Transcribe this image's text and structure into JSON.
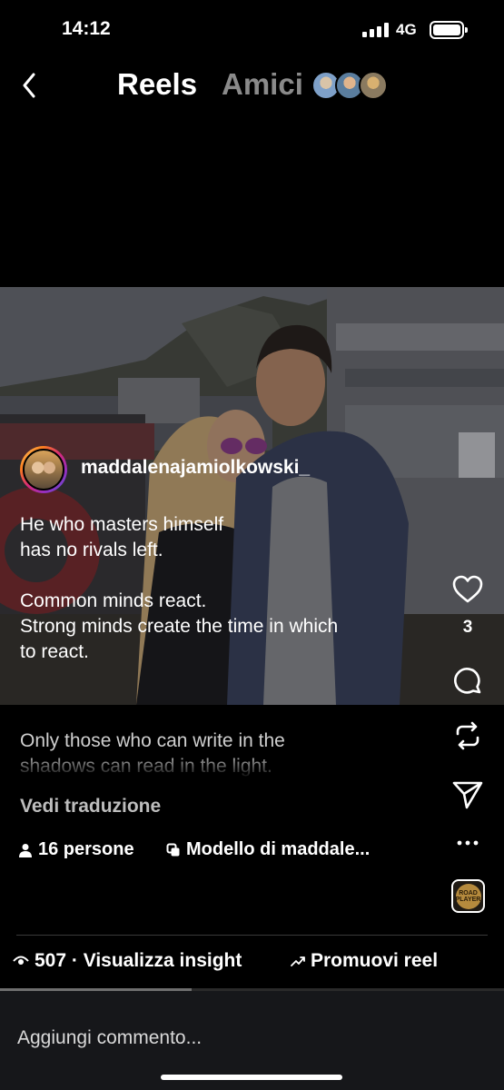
{
  "status": {
    "time": "14:12",
    "network": "4G",
    "battery_level": 1.0
  },
  "header": {
    "tabs": [
      {
        "label": "Reels",
        "active": true
      },
      {
        "label": "Amici",
        "active": false
      }
    ]
  },
  "post": {
    "author": "maddalenajamiolkowski_",
    "caption_lines": [
      "He who masters himself",
      "has no rivals left.",
      "",
      "Common minds react.",
      "Strong minds create the time in which",
      "to react."
    ],
    "caption_faded_lines": [
      "Only those who can write in the",
      "shadows can read in the light."
    ],
    "see_translation": "Vedi traduzione",
    "tagged_people": "16 persone",
    "template": "Modello di maddale...",
    "likes": "3",
    "audio_label": "ROAD PLAYER"
  },
  "insights": {
    "views": "507 · Visualizza insight",
    "promote": "Promuovi reel"
  },
  "comment": {
    "placeholder": "Aggiungi commento..."
  },
  "playback": {
    "progress": 0.38
  },
  "colors": {
    "background": "#000000",
    "muted_tab": "#8a8a8a",
    "comment_bar": "#16171a"
  }
}
